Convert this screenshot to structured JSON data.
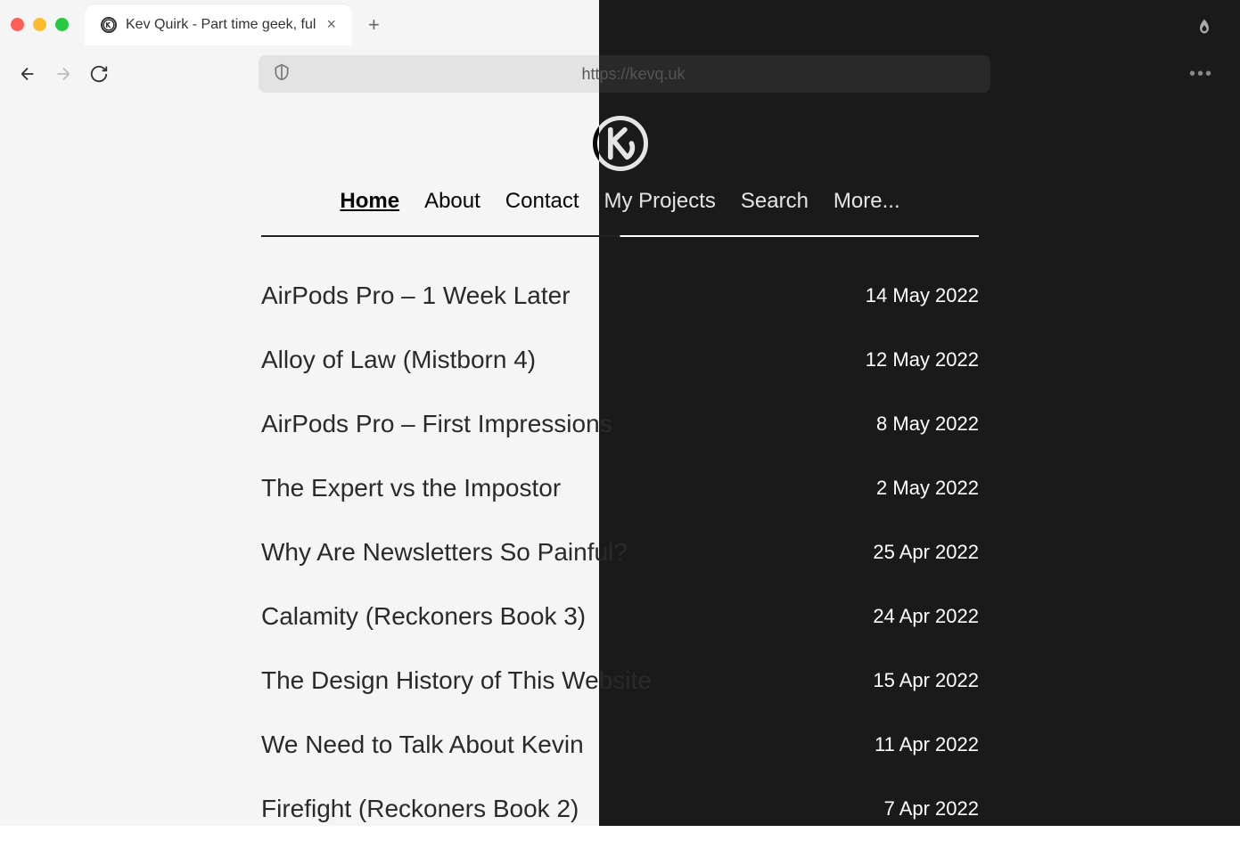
{
  "browser": {
    "tab_title": "Kev Quirk - Part time geek, ful",
    "url": "https://kevq.uk"
  },
  "nav": {
    "items": [
      {
        "label": "Home",
        "active": true
      },
      {
        "label": "About",
        "active": false
      },
      {
        "label": "Contact",
        "active": false
      },
      {
        "label": "My Projects",
        "active": false
      },
      {
        "label": "Search",
        "active": false
      },
      {
        "label": "More...",
        "active": false
      }
    ]
  },
  "posts": [
    {
      "title": "AirPods Pro – 1 Week Later",
      "date": "14 May 2022"
    },
    {
      "title": "Alloy of Law (Mistborn 4)",
      "date": "12 May 2022"
    },
    {
      "title": "AirPods Pro – First Impressions",
      "date": "8 May 2022"
    },
    {
      "title": "The Expert vs the Impostor",
      "date": "2 May 2022"
    },
    {
      "title": "Why Are Newsletters So Painful?",
      "date": "25 Apr 2022"
    },
    {
      "title": "Calamity (Reckoners Book 3)",
      "date": "24 Apr 2022"
    },
    {
      "title": "The Design History of This Website",
      "date": "15 Apr 2022"
    },
    {
      "title": "We Need to Talk About Kevin",
      "date": "11 Apr 2022"
    },
    {
      "title": "Firefight (Reckoners Book 2)",
      "date": "7 Apr 2022"
    }
  ]
}
